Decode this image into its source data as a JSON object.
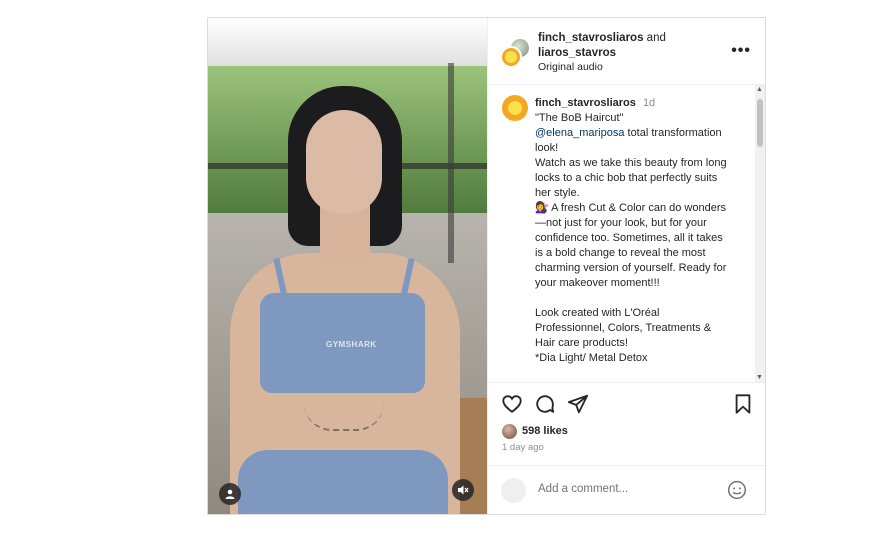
{
  "header": {
    "user_primary": "finch_stavrosliaros",
    "and_text": "and",
    "user_secondary": "liaros_stavros",
    "audio": "Original audio",
    "more_label": "•••"
  },
  "caption": {
    "username": "finch_stavrosliaros",
    "time_ago": "1d",
    "lines": [
      "\"The BoB Haircut\"",
      "@elena_mariposa total transformation",
      "look!",
      "Watch as we take this beauty from long",
      "locks to a chic bob that perfectly suits",
      "her style.",
      "💇‍♀️ A fresh Cut & Color can do wonders",
      "—not just for your look, but for your",
      "confidence too. Sometimes, all it takes",
      "is a bold change to reveal the most",
      "charming version of yourself. Ready for",
      "your makeover moment!!!",
      "",
      "Look created with L'Oréal",
      "Professionnel, Colors, Treatments &",
      "Hair care products!",
      "*Dia Light/ Metal Detox"
    ],
    "mention": "@elena_mariposa",
    "line1_rest": " total transformation"
  },
  "media": {
    "brand_text": "GYMSHARK"
  },
  "stats": {
    "likes": "598 likes",
    "date": "1 day ago"
  },
  "comment": {
    "placeholder": "Add a comment..."
  },
  "icons": [
    "heart-icon",
    "comment-icon",
    "share-icon",
    "bookmark-icon",
    "emoji-icon",
    "user-tag-icon",
    "mute-icon",
    "more-icon"
  ]
}
